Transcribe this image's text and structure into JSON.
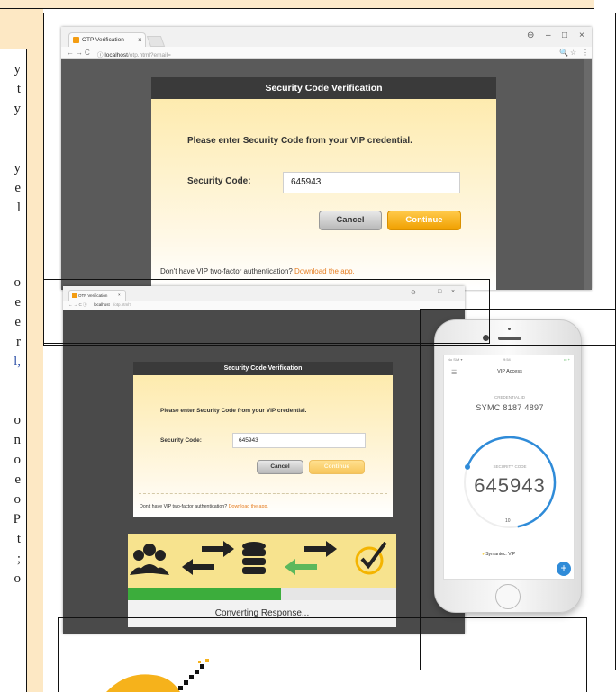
{
  "document": {
    "glyphs": [
      "y",
      "t",
      "y",
      "y",
      "e",
      "l",
      "o",
      "e",
      "e",
      "r",
      "l,",
      "o",
      "n",
      "o",
      "e",
      "o",
      "P",
      "t",
      ";",
      "o"
    ]
  },
  "browser_large": {
    "tab_label": "OTP Verification",
    "tab_close": "×",
    "url_host": "localhost",
    "url_path": "/otp.html?email=",
    "nav_back": "←",
    "nav_forward": "→",
    "nav_reload": "C",
    "nav_info": "ⓘ",
    "zoom_icon": "🔍",
    "star_icon": "☆",
    "menu_icon": "⋮",
    "win_account": "⊖",
    "win_min": "–",
    "win_max": "□",
    "win_close": "×",
    "dialog": {
      "title": "Security Code Verification",
      "prompt": "Please enter Security Code from your VIP credential.",
      "code_label": "Security Code:",
      "code_value": "645943",
      "cancel": "Cancel",
      "continue": "Continue",
      "footer_text": "Don't have VIP two-factor authentication?",
      "footer_link": "Download the app."
    }
  },
  "browser_small": {
    "tab_label": "OTP Verification",
    "tab_close": "×",
    "url_host": "localhost",
    "url_path": "/otp.html?",
    "win_account": "⊖",
    "win_min": "–",
    "win_max": "□",
    "win_close": "×",
    "dialog": {
      "title": "Security Code Verification",
      "prompt": "Please enter Security Code from your VIP credential.",
      "code_label": "Security Code:",
      "code_value": "645943",
      "cancel": "Cancel",
      "continue": "Continue",
      "footer_text": "Don't have VIP two-factor authentication?",
      "footer_link": "Download the app."
    },
    "status_panel": {
      "progress_fraction": 0.57,
      "status_text": "Converting Response..."
    }
  },
  "phone": {
    "status_left": "No SIM ▾",
    "status_time": "9:54",
    "status_right": "▭ +",
    "app_title": "VIP Access",
    "credential_label": "CREDENTIAL ID",
    "credential_id": "SYMC 8187 4897",
    "security_code_label": "SECURITY CODE",
    "security_code": "645943",
    "timer_seconds": "10",
    "brand": "Symantec. VIP",
    "fab_label": "+"
  },
  "colors": {
    "dialog_header": "#3a3a3a",
    "gold_button": "#f0a000",
    "link": "#e67e22",
    "progress": "#3cad3c",
    "phone_ring": "#2f8bd8",
    "browser_bg": "#5a5a5a"
  },
  "icons": {
    "flow": [
      "users-icon",
      "exchange-arrows-icon",
      "database-icon",
      "exchange-arrows-green-icon",
      "symantec-check-icon"
    ]
  }
}
